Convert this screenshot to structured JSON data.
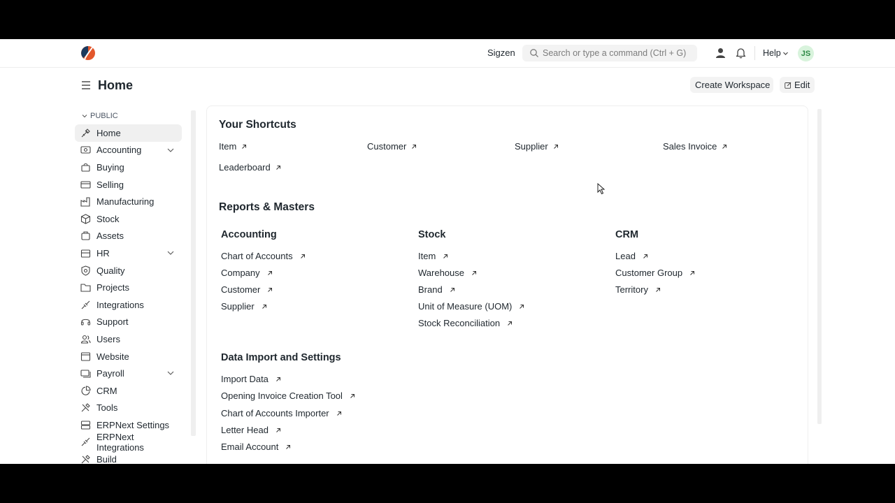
{
  "navbar": {
    "company": "Sigzen",
    "search_placeholder": "Search or type a command (Ctrl + G)",
    "help_label": "Help",
    "avatar_initials": "JS",
    "brand_color": "#e3572c"
  },
  "page": {
    "title": "Home",
    "create_workspace_label": "Create Workspace",
    "edit_label": "Edit"
  },
  "sidebar": {
    "section_label": "PUBLIC",
    "items": [
      {
        "label": "Home",
        "icon": "home-icon",
        "active": true
      },
      {
        "label": "Accounting",
        "icon": "accounting-icon",
        "expandable": true
      },
      {
        "label": "Buying",
        "icon": "buying-icon"
      },
      {
        "label": "Selling",
        "icon": "selling-icon"
      },
      {
        "label": "Manufacturing",
        "icon": "manufacturing-icon"
      },
      {
        "label": "Stock",
        "icon": "stock-icon"
      },
      {
        "label": "Assets",
        "icon": "assets-icon"
      },
      {
        "label": "HR",
        "icon": "hr-icon",
        "expandable": true
      },
      {
        "label": "Quality",
        "icon": "quality-icon"
      },
      {
        "label": "Projects",
        "icon": "projects-icon"
      },
      {
        "label": "Integrations",
        "icon": "integrations-icon"
      },
      {
        "label": "Support",
        "icon": "support-icon"
      },
      {
        "label": "Users",
        "icon": "users-icon"
      },
      {
        "label": "Website",
        "icon": "website-icon"
      },
      {
        "label": "Payroll",
        "icon": "payroll-icon",
        "expandable": true
      },
      {
        "label": "CRM",
        "icon": "crm-icon"
      },
      {
        "label": "Tools",
        "icon": "tools-icon"
      },
      {
        "label": "ERPNext Settings",
        "icon": "settings-icon"
      },
      {
        "label": "ERPNext Integrations",
        "icon": "integrations-icon"
      },
      {
        "label": "Build",
        "icon": "build-icon"
      }
    ]
  },
  "shortcuts": {
    "heading": "Your Shortcuts",
    "items": [
      "Item",
      "Customer",
      "Supplier",
      "Sales Invoice",
      "Leaderboard"
    ]
  },
  "reports": {
    "heading": "Reports & Masters",
    "cards": [
      {
        "title": "Accounting",
        "links": [
          "Chart of Accounts",
          "Company",
          "Customer",
          "Supplier"
        ]
      },
      {
        "title": "Stock",
        "links": [
          "Item",
          "Warehouse",
          "Brand",
          "Unit of Measure (UOM)",
          "Stock Reconciliation"
        ]
      },
      {
        "title": "CRM",
        "links": [
          "Lead",
          "Customer Group",
          "Territory"
        ]
      },
      {
        "title": "Data Import and Settings",
        "links": [
          "Import Data",
          "Opening Invoice Creation Tool",
          "Chart of Accounts Importer",
          "Letter Head",
          "Email Account"
        ]
      }
    ]
  }
}
